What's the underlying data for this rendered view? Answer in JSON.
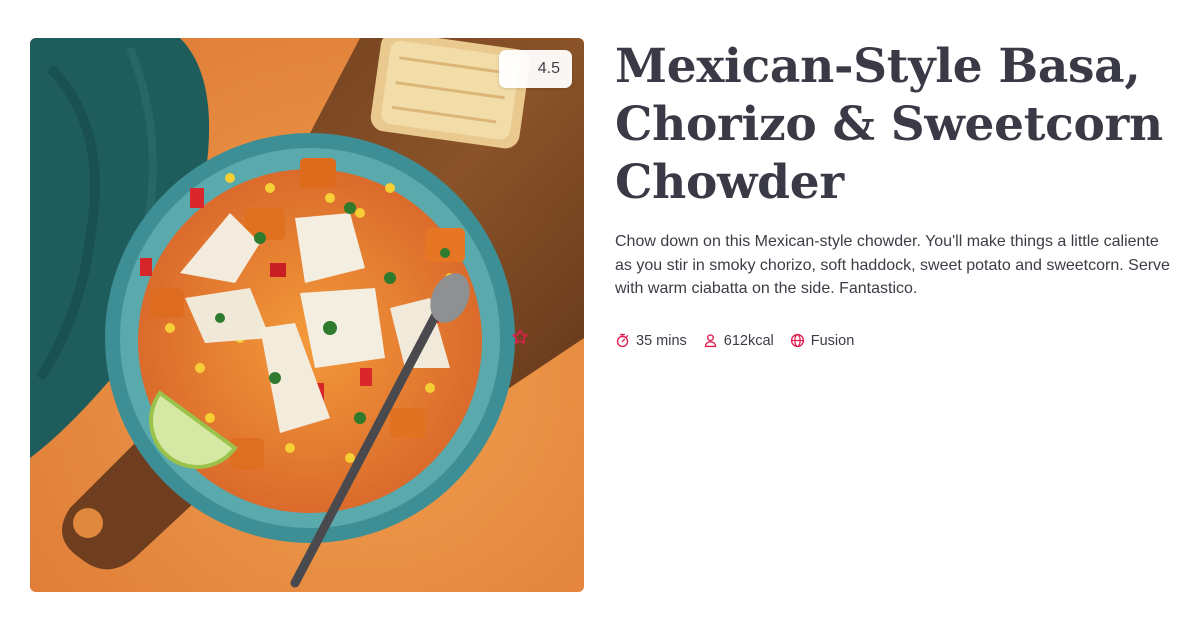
{
  "recipe": {
    "title": "Mexican-Style Basa, Chorizo & Sweetcorn Chowder",
    "description": "Chow down on this Mexican-style chowder. You'll make things a little caliente as you stir in smoky chorizo, soft haddock, sweet potato and sweetcorn. Serve with warm ciabatta on the side. Fantastico.",
    "rating": "4.5",
    "meta": {
      "time": "35 mins",
      "calories": "612kcal",
      "cuisine": "Fusion"
    }
  },
  "icons": {
    "rating": "star-icon",
    "time": "stopwatch-icon",
    "calories": "person-icon",
    "cuisine": "globe-icon"
  },
  "colors": {
    "accent": "#e01f4f",
    "text": "#3a3a46",
    "background_orange": "#e9893f"
  }
}
